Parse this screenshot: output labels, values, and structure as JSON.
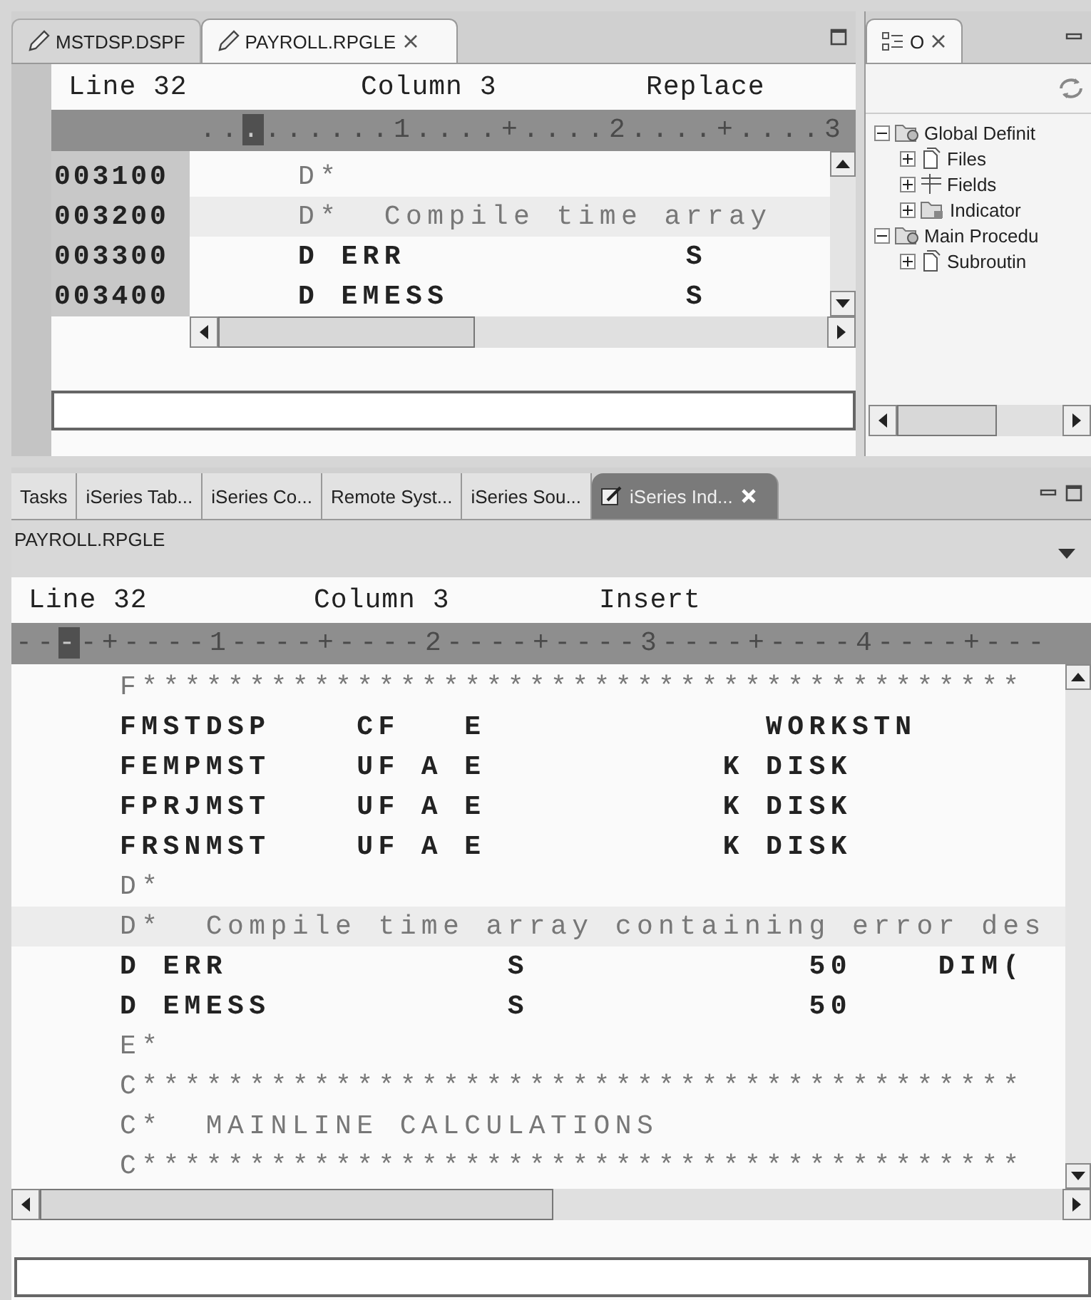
{
  "editor": {
    "tabs": [
      {
        "label": "MSTDSP.DSPF",
        "selected": false
      },
      {
        "label": "PAYROLL.RPGLE",
        "selected": true
      }
    ],
    "status": {
      "line": "Line 32",
      "column": "Column 3",
      "mode": "Replace"
    },
    "ruler": {
      "before": "..",
      "marker": ".",
      "after": "......1....+....2....+....3"
    },
    "lines": [
      {
        "number": "003100",
        "text": "D*",
        "kind": "comment",
        "current": false
      },
      {
        "number": "003200",
        "text": "D*  Compile time array",
        "kind": "comment",
        "current": true
      },
      {
        "number": "003300",
        "text": "D ERR             S",
        "kind": "code",
        "current": false
      },
      {
        "number": "003400",
        "text": "D EMESS           S",
        "kind": "code",
        "current": false
      }
    ]
  },
  "outline": {
    "tab": {
      "label": "O"
    },
    "tree": [
      {
        "label": "Global Definit",
        "expanded": true,
        "children": [
          {
            "label": "Files",
            "expanded": false
          },
          {
            "label": "Fields",
            "expanded": false
          },
          {
            "label": "Indicator",
            "expanded": false
          }
        ]
      },
      {
        "label": "Main Procedu",
        "expanded": true,
        "children": [
          {
            "label": "Subroutin",
            "expanded": false
          }
        ]
      }
    ]
  },
  "views": {
    "tabs": [
      {
        "label": "Tasks",
        "selected": false
      },
      {
        "label": "iSeries Tab...",
        "selected": false
      },
      {
        "label": "iSeries Co...",
        "selected": false
      },
      {
        "label": "Remote Syst...",
        "selected": false
      },
      {
        "label": "iSeries Sou...",
        "selected": false
      },
      {
        "label": "iSeries Ind...",
        "selected": true
      }
    ],
    "title": "PAYROLL.RPGLE",
    "status": {
      "line": "Line 32",
      "column": "Column 3",
      "mode": "Insert"
    },
    "ruler": {
      "before": "--",
      "marker": "-",
      "after": "-+----1----+----2----+----3----+----4----+---"
    },
    "lines": [
      {
        "text": "F*****************************************",
        "kind": "comment",
        "current": false
      },
      {
        "text": "FMSTDSP    CF   E             WORKSTN",
        "kind": "code",
        "current": false
      },
      {
        "text": "FEMPMST    UF A E           K DISK",
        "kind": "code",
        "current": false
      },
      {
        "text": "FPRJMST    UF A E           K DISK",
        "kind": "code",
        "current": false
      },
      {
        "text": "FRSNMST    UF A E           K DISK",
        "kind": "code",
        "current": false
      },
      {
        "text": "D*",
        "kind": "comment",
        "current": false
      },
      {
        "text": "D*  Compile time array containing error des",
        "kind": "comment",
        "current": true
      },
      {
        "text": "D ERR             S             50    DIM(",
        "kind": "code",
        "current": false
      },
      {
        "text": "D EMESS           S             50",
        "kind": "code",
        "current": false
      },
      {
        "text": "E*",
        "kind": "comment",
        "current": false
      },
      {
        "text": "C*****************************************",
        "kind": "comment",
        "current": false
      },
      {
        "text": "C*  MAINLINE CALCULATIONS",
        "kind": "comment",
        "current": false
      },
      {
        "text": "C*****************************************",
        "kind": "comment",
        "current": false
      }
    ]
  }
}
